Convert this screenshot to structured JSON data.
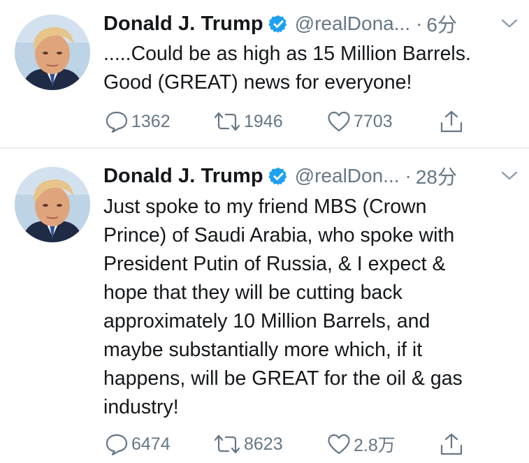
{
  "tweets": [
    {
      "display_name": "Donald J. Trump",
      "verified_icon": "verified-badge-icon",
      "handle": "@realDona...",
      "separator": "·",
      "time": "6分",
      "text": ".....Could be as high as 15 Million Barrels.\nGood (GREAT) news for everyone!",
      "replies": "1362",
      "retweets": "1946",
      "likes": "7703"
    },
    {
      "display_name": "Donald J. Trump",
      "verified_icon": "verified-badge-icon",
      "handle": "@realDon...",
      "separator": "·",
      "time": "28分",
      "text": "Just spoke to my friend MBS (Crown\nPrince) of Saudi Arabia, who spoke with\nPresident Putin of Russia, & I expect &\nhope that they will be cutting back\napproximately 10 Million Barrels, and\nmaybe substantially more which, if it\nhappens, will be GREAT for the oil & gas\nindustry!",
      "replies": "6474",
      "retweets": "8623",
      "likes": "2.8万"
    }
  ],
  "icons": {
    "reply": "reply-icon",
    "retweet": "retweet-icon",
    "like": "heart-icon",
    "share": "share-icon",
    "more": "chevron-down-icon"
  },
  "colors": {
    "text": "#14171a",
    "secondary": "#657786",
    "verified": "#1da1f2",
    "divider": "#e6ecf0"
  }
}
